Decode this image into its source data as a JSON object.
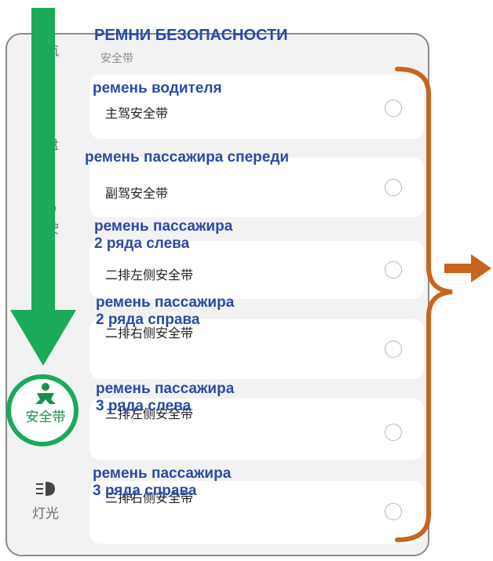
{
  "sidebar": {
    "items": [
      {
        "label": "导航"
      },
      {
        "label": "表盘"
      },
      {
        "label": "驾驶"
      },
      {
        "label": "车辆"
      },
      {
        "label": "安全带"
      },
      {
        "label": "灯光"
      }
    ]
  },
  "overlay": {
    "title": "РЕМНИ БЕЗОПАСНОСТИ"
  },
  "section": {
    "subtitle": "安全带"
  },
  "belts": [
    {
      "ru_line1": "ремень водителя",
      "ru_line2": "",
      "label": "主驾安全带"
    },
    {
      "ru_line1": "ремень пассажира спереди",
      "ru_line2": "",
      "label": "副驾安全带"
    },
    {
      "ru_line1": "ремень пассажира",
      "ru_line2": "2 ряда слева",
      "label": "二排左侧安全带"
    },
    {
      "ru_line1": "ремень пассажира",
      "ru_line2": "2 ряда справа",
      "label": "二排右侧安全带"
    },
    {
      "ru_line1": "ремень пассажира",
      "ru_line2": "3 ряда слева",
      "label": "三排左侧安全带"
    },
    {
      "ru_line1": "ремень пассажира",
      "ru_line2": "3 ряда справа",
      "label": "三排右侧安全带"
    }
  ],
  "colors": {
    "annotation_text": "#2b4aa8",
    "green_arrow": "#1ba95a",
    "orange_bracket": "#c8641e",
    "active_tab": "#1a8f4e"
  },
  "icons": [
    "seatbelt-icon",
    "headlight-icon",
    "down-arrow-icon",
    "right-arrow-icon",
    "bracket-icon"
  ]
}
